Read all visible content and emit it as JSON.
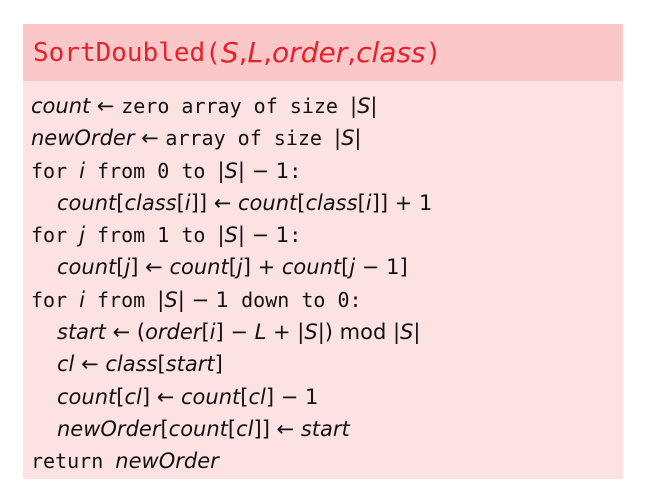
{
  "header": {
    "func_name": "SortDoubled",
    "open_paren": "(",
    "params": [
      "S",
      "L",
      "order",
      "class"
    ],
    "comma": ", ",
    "close_paren": ")"
  },
  "lines": [
    {
      "segments": [
        {
          "t": "it",
          "v": "count"
        },
        {
          "t": "up",
          "v": " ← "
        },
        {
          "t": "kw",
          "v": "zero array of size "
        },
        {
          "t": "up",
          "v": "|"
        },
        {
          "t": "it",
          "v": "S"
        },
        {
          "t": "up",
          "v": "|"
        }
      ]
    },
    {
      "segments": [
        {
          "t": "it",
          "v": "newOrder"
        },
        {
          "t": "up",
          "v": " ← "
        },
        {
          "t": "kw",
          "v": "array of size "
        },
        {
          "t": "up",
          "v": "|"
        },
        {
          "t": "it",
          "v": "S"
        },
        {
          "t": "up",
          "v": "|"
        }
      ]
    },
    {
      "segments": [
        {
          "t": "kw",
          "v": "for "
        },
        {
          "t": "it",
          "v": "i"
        },
        {
          "t": "kw",
          "v": " from 0 to "
        },
        {
          "t": "up",
          "v": "|"
        },
        {
          "t": "it",
          "v": "S"
        },
        {
          "t": "up",
          "v": "| − 1"
        },
        {
          "t": "kw",
          "v": ":"
        }
      ]
    },
    {
      "indent": true,
      "segments": [
        {
          "t": "it",
          "v": "count"
        },
        {
          "t": "up",
          "v": "["
        },
        {
          "t": "it",
          "v": "class"
        },
        {
          "t": "up",
          "v": "["
        },
        {
          "t": "it",
          "v": "i"
        },
        {
          "t": "up",
          "v": "]] ← "
        },
        {
          "t": "it",
          "v": "count"
        },
        {
          "t": "up",
          "v": "["
        },
        {
          "t": "it",
          "v": "class"
        },
        {
          "t": "up",
          "v": "["
        },
        {
          "t": "it",
          "v": "i"
        },
        {
          "t": "up",
          "v": "]] + 1"
        }
      ]
    },
    {
      "segments": [
        {
          "t": "kw",
          "v": "for "
        },
        {
          "t": "it",
          "v": "j"
        },
        {
          "t": "kw",
          "v": " from 1 to "
        },
        {
          "t": "up",
          "v": "|"
        },
        {
          "t": "it",
          "v": "S"
        },
        {
          "t": "up",
          "v": "| − 1"
        },
        {
          "t": "kw",
          "v": ":"
        }
      ]
    },
    {
      "indent": true,
      "segments": [
        {
          "t": "it",
          "v": "count"
        },
        {
          "t": "up",
          "v": "["
        },
        {
          "t": "it",
          "v": "j"
        },
        {
          "t": "up",
          "v": "] ← "
        },
        {
          "t": "it",
          "v": "count"
        },
        {
          "t": "up",
          "v": "["
        },
        {
          "t": "it",
          "v": "j"
        },
        {
          "t": "up",
          "v": "] + "
        },
        {
          "t": "it",
          "v": "count"
        },
        {
          "t": "up",
          "v": "["
        },
        {
          "t": "it",
          "v": "j"
        },
        {
          "t": "up",
          "v": " − 1]"
        }
      ]
    },
    {
      "segments": [
        {
          "t": "kw",
          "v": "for "
        },
        {
          "t": "it",
          "v": "i"
        },
        {
          "t": "kw",
          "v": " from "
        },
        {
          "t": "up",
          "v": "|"
        },
        {
          "t": "it",
          "v": "S"
        },
        {
          "t": "up",
          "v": "| − 1"
        },
        {
          "t": "kw",
          "v": " down to 0:"
        }
      ]
    },
    {
      "indent": true,
      "segments": [
        {
          "t": "it",
          "v": "start"
        },
        {
          "t": "up",
          "v": " ← ("
        },
        {
          "t": "it",
          "v": "order"
        },
        {
          "t": "up",
          "v": "["
        },
        {
          "t": "it",
          "v": "i"
        },
        {
          "t": "up",
          "v": "] − "
        },
        {
          "t": "it",
          "v": "L"
        },
        {
          "t": "up",
          "v": " + |"
        },
        {
          "t": "it",
          "v": "S"
        },
        {
          "t": "up",
          "v": "|)  mod |"
        },
        {
          "t": "it",
          "v": "S"
        },
        {
          "t": "up",
          "v": "|"
        }
      ]
    },
    {
      "indent": true,
      "segments": [
        {
          "t": "it",
          "v": "cl"
        },
        {
          "t": "up",
          "v": " ← "
        },
        {
          "t": "it",
          "v": "class"
        },
        {
          "t": "up",
          "v": "["
        },
        {
          "t": "it",
          "v": "start"
        },
        {
          "t": "up",
          "v": "]"
        }
      ]
    },
    {
      "indent": true,
      "segments": [
        {
          "t": "it",
          "v": "count"
        },
        {
          "t": "up",
          "v": "["
        },
        {
          "t": "it",
          "v": "cl"
        },
        {
          "t": "up",
          "v": "] ← "
        },
        {
          "t": "it",
          "v": "count"
        },
        {
          "t": "up",
          "v": "["
        },
        {
          "t": "it",
          "v": "cl"
        },
        {
          "t": "up",
          "v": "] − 1"
        }
      ]
    },
    {
      "indent": true,
      "segments": [
        {
          "t": "it",
          "v": "newOrder"
        },
        {
          "t": "up",
          "v": "["
        },
        {
          "t": "it",
          "v": "count"
        },
        {
          "t": "up",
          "v": "["
        },
        {
          "t": "it",
          "v": "cl"
        },
        {
          "t": "up",
          "v": "]] ← "
        },
        {
          "t": "it",
          "v": "start"
        }
      ]
    },
    {
      "segments": [
        {
          "t": "kw",
          "v": "return "
        },
        {
          "t": "it",
          "v": "newOrder"
        }
      ]
    }
  ],
  "colors": {
    "header_bg": "#fbc7c9",
    "body_bg": "#fde2e4",
    "title_color": "#e8202a",
    "text_color": "#111111"
  }
}
